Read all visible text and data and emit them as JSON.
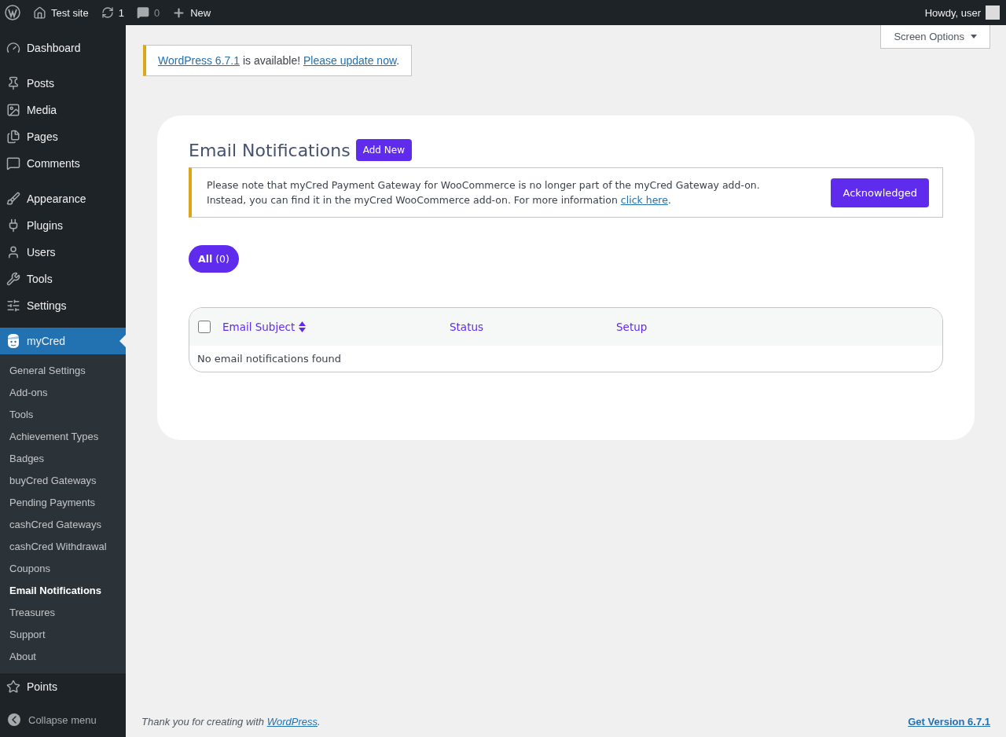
{
  "admin_bar": {
    "site": "Test site",
    "updates": "1",
    "comments": "0",
    "new": "New",
    "greeting": "Howdy, user"
  },
  "sidebar": {
    "groups": [
      [
        {
          "label": "Dashboard",
          "selected": false
        }
      ],
      [
        {
          "label": "Posts",
          "selected": false
        },
        {
          "label": "Media",
          "selected": false
        },
        {
          "label": "Pages",
          "selected": false
        },
        {
          "label": "Comments",
          "selected": false
        }
      ],
      [
        {
          "label": "Appearance",
          "selected": false
        },
        {
          "label": "Plugins",
          "selected": false
        },
        {
          "label": "Users",
          "selected": false
        },
        {
          "label": "Tools",
          "selected": false
        },
        {
          "label": "Settings",
          "selected": false
        }
      ],
      [
        {
          "label": "myCred",
          "selected": true,
          "children": [
            {
              "label": "General Settings",
              "selected": false
            },
            {
              "label": "Add-ons",
              "selected": false
            },
            {
              "label": "Tools",
              "selected": false
            },
            {
              "label": "Achievement Types",
              "selected": false
            },
            {
              "label": "Badges",
              "selected": false
            },
            {
              "label": "buyCred Gateways",
              "selected": false
            },
            {
              "label": "Pending Payments",
              "selected": false
            },
            {
              "label": "cashCred Gateways",
              "selected": false
            },
            {
              "label": "cashCred Withdrawal",
              "selected": false
            },
            {
              "label": "Coupons",
              "selected": false
            },
            {
              "label": "Email Notifications",
              "selected": true
            },
            {
              "label": "Treasures",
              "selected": false
            },
            {
              "label": "Support",
              "selected": false
            },
            {
              "label": "About",
              "selected": false
            }
          ]
        },
        {
          "label": "Points",
          "selected": false
        }
      ]
    ],
    "collapse": "Collapse menu"
  },
  "screen_options": "Screen Options",
  "update_notice": [
    {
      "kind": "link",
      "text": "WordPress 6.7.1"
    },
    {
      "kind": "text",
      "text": " is available! "
    },
    {
      "kind": "link",
      "text": "Please update now"
    },
    {
      "kind": "text",
      "text": "."
    }
  ],
  "page": {
    "title": "Email Notifications",
    "add_new": "Add New",
    "notice": {
      "lines": [
        [
          {
            "kind": "text",
            "text": "Please note that myCred Payment Gateway for WooCommerce is no longer part of the myCred Gateway add-on."
          }
        ],
        [
          {
            "kind": "text",
            "text": "Instead, you can find it in the myCred WooCommerce add-on. For more information "
          },
          {
            "kind": "link",
            "text": "click here"
          },
          {
            "kind": "text",
            "text": "."
          }
        ]
      ],
      "button": "Acknowledged"
    },
    "filters": [
      {
        "label": "All",
        "count": "(0)",
        "selected": true
      }
    ],
    "table": {
      "select_all": {
        "checked": false
      },
      "columns": [
        {
          "label": "Email Subject",
          "sortable": true
        },
        {
          "label": "Status",
          "sortable": false
        },
        {
          "label": "Setup",
          "sortable": false
        }
      ],
      "empty": "No email notifications found"
    }
  },
  "footer": {
    "thanks": [
      {
        "kind": "text",
        "text": "Thank you for creating with "
      },
      {
        "kind": "link",
        "text": "WordPress"
      },
      {
        "kind": "text",
        "text": "."
      }
    ],
    "version": "Get Version 6.7.1"
  }
}
